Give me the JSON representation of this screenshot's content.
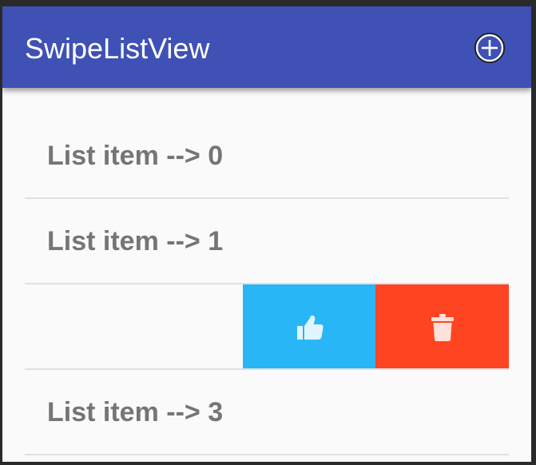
{
  "app_bar": {
    "title": "SwipeListView",
    "color": "#3f51b5",
    "add_icon": "add-circle-icon"
  },
  "list": {
    "items": [
      {
        "label": "List item --> 0"
      },
      {
        "label": "List item --> 1"
      },
      {
        "label": "",
        "swiped": true
      },
      {
        "label": "List item --> 3"
      }
    ],
    "swipe_actions": {
      "like": {
        "icon": "thumbs-up-icon",
        "color": "#29b6f6"
      },
      "delete": {
        "icon": "trash-icon",
        "color": "#ff4422"
      }
    }
  }
}
